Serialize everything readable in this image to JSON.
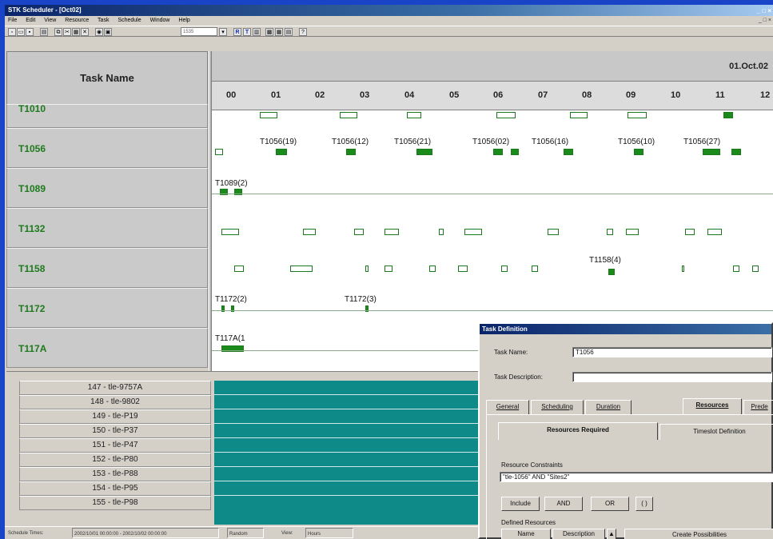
{
  "window": {
    "title": "STK Scheduler - [Oct02]",
    "controls": "_ □ ×"
  },
  "menu": [
    "File",
    "Edit",
    "View",
    "Resource",
    "Task",
    "Schedule",
    "Window",
    "Help"
  ],
  "toolbar": {
    "zoom_value": "1535",
    "letter_buttons": [
      "R",
      "T"
    ]
  },
  "task_panel": {
    "header": "Task Name",
    "rows": [
      "T1010",
      "T1056",
      "T1089",
      "T1132",
      "T1158",
      "T1172",
      "T117A"
    ]
  },
  "timeline": {
    "date": "01.Oct.02",
    "hours": [
      "00",
      "01",
      "02",
      "03",
      "04",
      "05",
      "06",
      "07",
      "08",
      "09",
      "10",
      "11",
      "12"
    ],
    "labels": [
      {
        "text": "T1056(19)"
      },
      {
        "text": "T1056(12)"
      },
      {
        "text": "T1056(21)"
      },
      {
        "text": "T1056(02)"
      },
      {
        "text": "T1056(16)"
      },
      {
        "text": "T1056(10)"
      },
      {
        "text": "T1056(27)"
      },
      {
        "text": "T1089(2)"
      },
      {
        "text": "T1158(4)"
      },
      {
        "text": "T1172(2)"
      },
      {
        "text": "T1172(3)"
      },
      {
        "text": "T117A(1"
      }
    ]
  },
  "resources": [
    "147 - tle-9757A",
    "148 - tle-9802",
    "149 - tle-P19",
    "150 - tle-P37",
    "151 - tle-P47",
    "152 - tle-P80",
    "153 - tle-P88",
    "154 - tle-P95",
    "155 - tle-P98"
  ],
  "statusbar": {
    "label": "Schedule Times:",
    "range": "2002/10/01 00:00:00 - 2002/10/02 00:00:00",
    "mode": "Random",
    "view_label": "View:",
    "view_value": "Hours"
  },
  "dialog": {
    "title": "Task Definition",
    "task_name_label": "Task Name:",
    "task_name_value": "T1056",
    "task_desc_label": "Task Description:",
    "task_desc_value": "",
    "tabs": [
      "General",
      "Scheduling",
      "Duration",
      "Resources",
      "Prede"
    ],
    "active_tab": "Resources",
    "subtabs": [
      "Resources Required",
      "Timeslot Definition"
    ],
    "constraints_label": "Resource Constraints",
    "constraints_value": "\"tle-1056\" AND \"Sites2\"",
    "buttons": [
      "Include",
      "AND",
      "OR",
      "( )"
    ],
    "defined_label": "Defined Resources",
    "columns": [
      "Name",
      "Description"
    ],
    "create_button": "Create Possibilities"
  },
  "colors": {
    "task_green": "#1d7a1d",
    "bar_fill": "#1a8a1a",
    "resource_teal": "#0e8a88",
    "title_blue": "#0a246a"
  }
}
